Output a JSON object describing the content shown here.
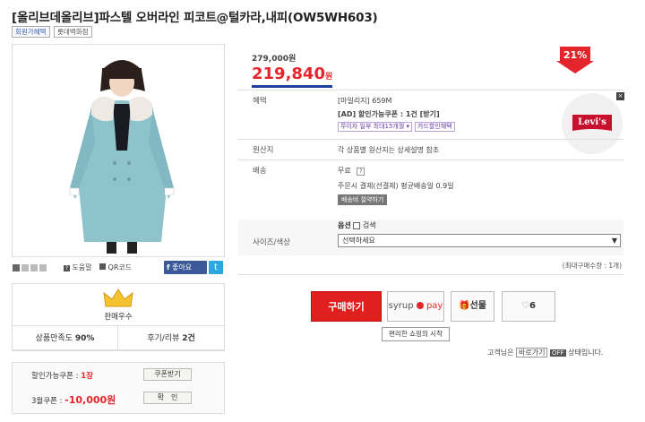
{
  "product": {
    "title": "[올리브데올리브]파스텔 오버라인 피코트@털카라,내피(OW5WH603)",
    "tags": [
      "회원가혜택",
      "롯데백화점"
    ],
    "original_price": "279,000원",
    "price": "219,840",
    "price_unit": "원",
    "discount": "21%"
  },
  "gallery": {
    "help_link": "도움말",
    "qr_link": "QR코드",
    "facebook_label": "좋아요",
    "twitter_glyph": "t"
  },
  "seller": {
    "grade": "판매우수",
    "satisfaction_label": "상품만족도",
    "satisfaction_value": "90%",
    "review_label": "후기/리뷰",
    "review_value": "2건"
  },
  "coupons": {
    "available_label": "할인가능쿠폰 :",
    "available_count": "1장",
    "get_coupon_btn": "쿠폰받기",
    "march_label": "3월쿠폰 :",
    "march_value": "-10,000원",
    "confirm_btn": "확　인"
  },
  "info": {
    "benefit_label": "혜택",
    "mileage": "[마일리지] 659M",
    "ad_coupon": "[AD] 할인가능쿠폰 : 1건 [받기]",
    "installment_btn": "무이자 일부 최대15개월 ▾",
    "card_btn": "카드할인혜택",
    "origin_label": "원산지",
    "origin_value": "각 상품별 원산지는 상세설명 참조",
    "shipping_label": "배송",
    "shipping_value": "무료",
    "shipping_help": "?",
    "shipping_detail": "주문시 결제(선결제) 평균배송일 0.9일",
    "shipping_calc_btn": "배송비 절약하기",
    "option_label": "사이즈/색상",
    "option_title": "옵션",
    "option_search": "검색",
    "select_placeholder": "선택하세요",
    "max_qty": "(최대구매수량 : 1개)"
  },
  "ad": {
    "brand": "Levi's"
  },
  "actions": {
    "buy_btn": "구매하기",
    "syrup_text": "syrup",
    "pay_text": "pay",
    "gift_btn": "선물",
    "like_count": "6",
    "tooltip": "편리한 쇼핑의 시작",
    "customer_prefix": "고객님은",
    "baro_btn": "바로가기",
    "off_badge": "OFF",
    "customer_suffix": "상태입니다."
  },
  "colors": {
    "price_red": "#e4262c",
    "buy_red": "#e0201e",
    "coat_blue": "#8ec3cc",
    "facebook": "#3b5998",
    "twitter": "#2aa9e0"
  }
}
